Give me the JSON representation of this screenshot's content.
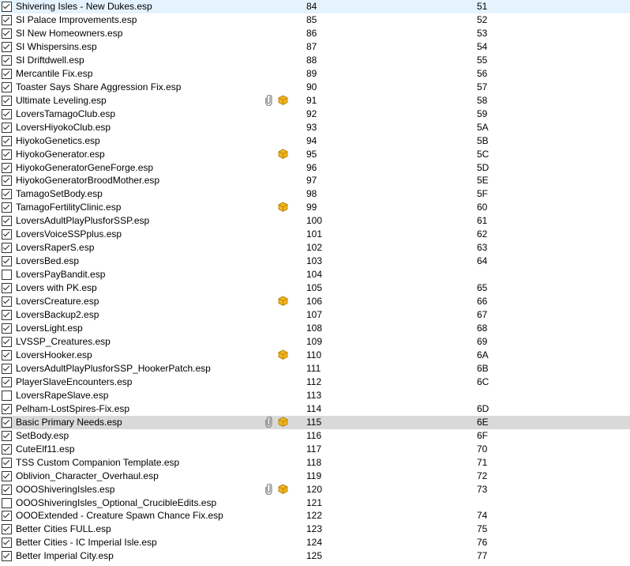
{
  "plugins": [
    {
      "name": "Shivering Isles - New Dukes.esp",
      "checked": true,
      "priority": "84",
      "index": "51",
      "icons": [],
      "state": "top"
    },
    {
      "name": "SI Palace Improvements.esp",
      "checked": true,
      "priority": "85",
      "index": "52",
      "icons": []
    },
    {
      "name": "SI New Homeowners.esp",
      "checked": true,
      "priority": "86",
      "index": "53",
      "icons": []
    },
    {
      "name": "SI Whispersins.esp",
      "checked": true,
      "priority": "87",
      "index": "54",
      "icons": []
    },
    {
      "name": "SI Driftdwell.esp",
      "checked": true,
      "priority": "88",
      "index": "55",
      "icons": []
    },
    {
      "name": "Mercantile Fix.esp",
      "checked": true,
      "priority": "89",
      "index": "56",
      "icons": []
    },
    {
      "name": "Toaster Says Share Aggression Fix.esp",
      "checked": true,
      "priority": "90",
      "index": "57",
      "icons": []
    },
    {
      "name": "Ultimate Leveling.esp",
      "checked": true,
      "priority": "91",
      "index": "58",
      "icons": [
        "archive",
        "info"
      ]
    },
    {
      "name": "LoversTamagoClub.esp",
      "checked": true,
      "priority": "92",
      "index": "59",
      "icons": []
    },
    {
      "name": "LoversHiyokoClub.esp",
      "checked": true,
      "priority": "93",
      "index": "5A",
      "icons": []
    },
    {
      "name": "HiyokoGenetics.esp",
      "checked": true,
      "priority": "94",
      "index": "5B",
      "icons": []
    },
    {
      "name": "HiyokoGenerator.esp",
      "checked": true,
      "priority": "95",
      "index": "5C",
      "icons": [
        "info"
      ]
    },
    {
      "name": "HiyokoGeneratorGeneForge.esp",
      "checked": true,
      "priority": "96",
      "index": "5D",
      "icons": []
    },
    {
      "name": "HiyokoGeneratorBroodMother.esp",
      "checked": true,
      "priority": "97",
      "index": "5E",
      "icons": []
    },
    {
      "name": "TamagoSetBody.esp",
      "checked": true,
      "priority": "98",
      "index": "5F",
      "icons": []
    },
    {
      "name": "TamagoFertilityClinic.esp",
      "checked": true,
      "priority": "99",
      "index": "60",
      "icons": [
        "info"
      ]
    },
    {
      "name": "LoversAdultPlayPlusforSSP.esp",
      "checked": true,
      "priority": "100",
      "index": "61",
      "icons": []
    },
    {
      "name": "LoversVoiceSSPplus.esp",
      "checked": true,
      "priority": "101",
      "index": "62",
      "icons": []
    },
    {
      "name": "LoversRaperS.esp",
      "checked": true,
      "priority": "102",
      "index": "63",
      "icons": []
    },
    {
      "name": "LoversBed.esp",
      "checked": true,
      "priority": "103",
      "index": "64",
      "icons": []
    },
    {
      "name": "LoversPayBandit.esp",
      "checked": false,
      "priority": "104",
      "index": "",
      "icons": []
    },
    {
      "name": "Lovers with PK.esp",
      "checked": true,
      "priority": "105",
      "index": "65",
      "icons": []
    },
    {
      "name": "LoversCreature.esp",
      "checked": true,
      "priority": "106",
      "index": "66",
      "icons": [
        "info"
      ]
    },
    {
      "name": "LoversBackup2.esp",
      "checked": true,
      "priority": "107",
      "index": "67",
      "icons": []
    },
    {
      "name": "LoversLight.esp",
      "checked": true,
      "priority": "108",
      "index": "68",
      "icons": []
    },
    {
      "name": "LVSSP_Creatures.esp",
      "checked": true,
      "priority": "109",
      "index": "69",
      "icons": []
    },
    {
      "name": "LoversHooker.esp",
      "checked": true,
      "priority": "110",
      "index": "6A",
      "icons": [
        "info"
      ]
    },
    {
      "name": "LoversAdultPlayPlusforSSP_HookerPatch.esp",
      "checked": true,
      "priority": "111",
      "index": "6B",
      "icons": []
    },
    {
      "name": "PlayerSlaveEncounters.esp",
      "checked": true,
      "priority": "112",
      "index": "6C",
      "icons": []
    },
    {
      "name": "LoversRapeSlave.esp",
      "checked": false,
      "priority": "113",
      "index": "",
      "icons": []
    },
    {
      "name": "Pelham-LostSpires-Fix.esp",
      "checked": true,
      "priority": "114",
      "index": "6D",
      "icons": []
    },
    {
      "name": "Basic Primary Needs.esp",
      "checked": true,
      "priority": "115",
      "index": "6E",
      "icons": [
        "archive",
        "info"
      ],
      "state": "selected"
    },
    {
      "name": "SetBody.esp",
      "checked": true,
      "priority": "116",
      "index": "6F",
      "icons": []
    },
    {
      "name": "CuteElf11.esp",
      "checked": true,
      "priority": "117",
      "index": "70",
      "icons": []
    },
    {
      "name": "TSS Custom Companion  Template.esp",
      "checked": true,
      "priority": "118",
      "index": "71",
      "icons": []
    },
    {
      "name": "Oblivion_Character_Overhaul.esp",
      "checked": true,
      "priority": "119",
      "index": "72",
      "icons": []
    },
    {
      "name": "OOOShiveringIsles.esp",
      "checked": true,
      "priority": "120",
      "index": "73",
      "icons": [
        "archive",
        "info"
      ]
    },
    {
      "name": "OOOShiveringIsles_Optional_CrucibleEdits.esp",
      "checked": false,
      "priority": "121",
      "index": "",
      "icons": []
    },
    {
      "name": "OOOExtended - Creature Spawn Chance Fix.esp",
      "checked": true,
      "priority": "122",
      "index": "74",
      "icons": []
    },
    {
      "name": "Better Cities FULL.esp",
      "checked": true,
      "priority": "123",
      "index": "75",
      "icons": []
    },
    {
      "name": "Better Cities - IC Imperial Isle.esp",
      "checked": true,
      "priority": "124",
      "index": "76",
      "icons": []
    },
    {
      "name": "Better Imperial City.esp",
      "checked": true,
      "priority": "125",
      "index": "77",
      "icons": []
    }
  ],
  "colors": {
    "top_row": "#e5f3ff",
    "selected_row": "#d9d9d9",
    "archive_icon": "#8a8a8a",
    "info_icon": "#f2b51c"
  }
}
